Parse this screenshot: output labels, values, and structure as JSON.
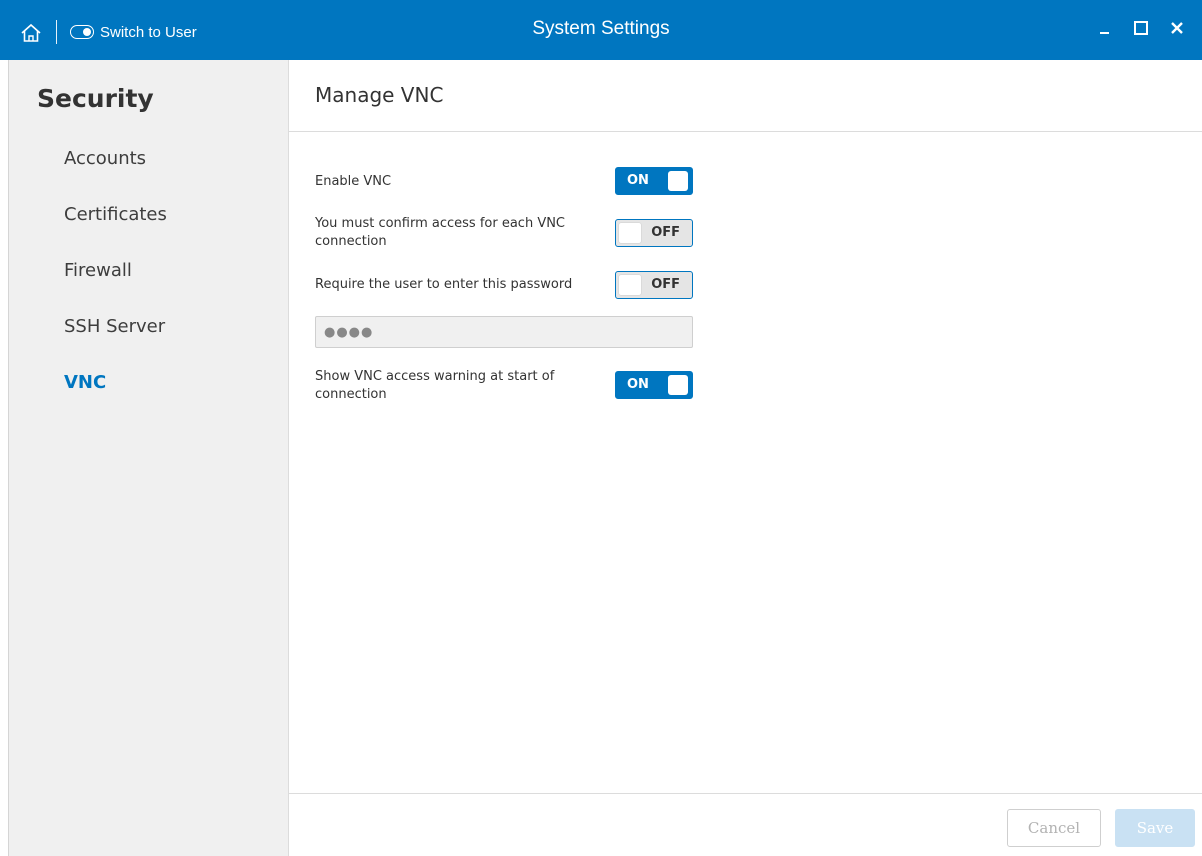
{
  "titlebar": {
    "switch_label": "Switch to User",
    "title": "System Settings",
    "home_icon": "home-icon",
    "minimize_icon": "minimize-icon",
    "maximize_icon": "maximize-icon",
    "close_icon": "close-icon",
    "color": "#0076c0"
  },
  "sidebar": {
    "title": "Security",
    "items": [
      {
        "label": "Accounts",
        "active": false
      },
      {
        "label": "Certificates",
        "active": false
      },
      {
        "label": "Firewall",
        "active": false
      },
      {
        "label": "SSH Server",
        "active": false
      },
      {
        "label": "VNC",
        "active": true
      }
    ]
  },
  "main": {
    "title": "Manage VNC",
    "settings": {
      "enable_vnc": {
        "label": "Enable VNC",
        "state": "ON"
      },
      "confirm_access": {
        "label": "You must confirm access for each VNC connection",
        "state": "OFF"
      },
      "require_password": {
        "label": "Require the user to enter this password",
        "state": "OFF"
      },
      "password": {
        "value": "●●●●"
      },
      "show_warning": {
        "label": "Show VNC access warning at start of connection",
        "state": "ON"
      }
    },
    "footer": {
      "cancel_label": "Cancel",
      "save_label": "Save"
    }
  }
}
